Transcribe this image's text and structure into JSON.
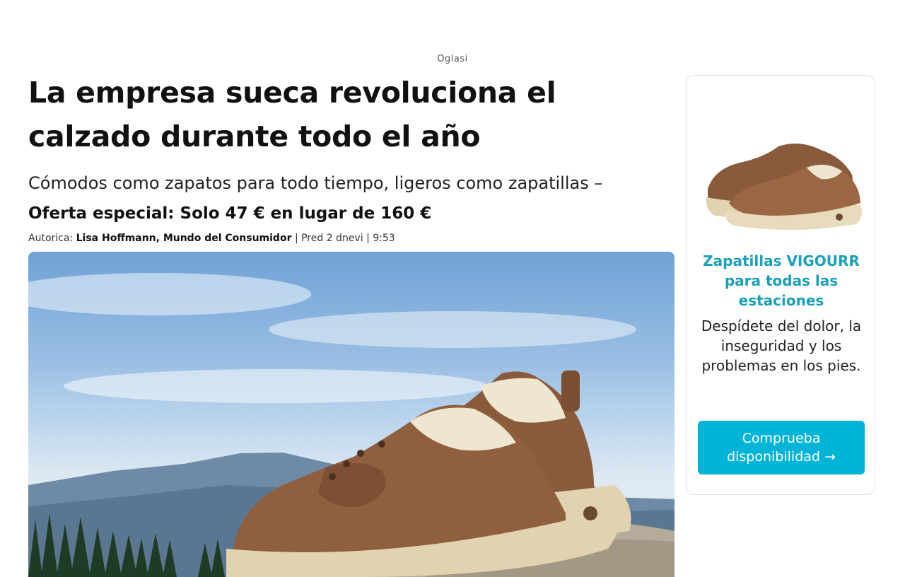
{
  "ad_label": "Oglasi",
  "article": {
    "headline": "La empresa sueca revoluciona el calzado durante todo el año",
    "subtitle": "Cómodos como zapatos para todo tiempo, ligeros como zapatillas –",
    "offer": "Oferta especial: Solo 47 € en lugar de 160 €",
    "byline": {
      "prefix": "Autorica:",
      "authors": "Lisa Hoffmann, Mundo del Consumidor",
      "separator1": "| Pred 2 dnevi",
      "separator2": "| 9:53"
    }
  },
  "sidebar": {
    "title": "Zapatillas VIGOURR para todas las estaciones",
    "description": "Despídete del dolor, la inseguridad y los problemas en los pies.",
    "cta_label": "Comprueba disponibilidad →"
  },
  "colors": {
    "accent": "#00b4d8",
    "title_teal": "#1aa0b8",
    "shoe_brown": "#8a5a3c",
    "sole_beige": "#e2d3b0"
  }
}
